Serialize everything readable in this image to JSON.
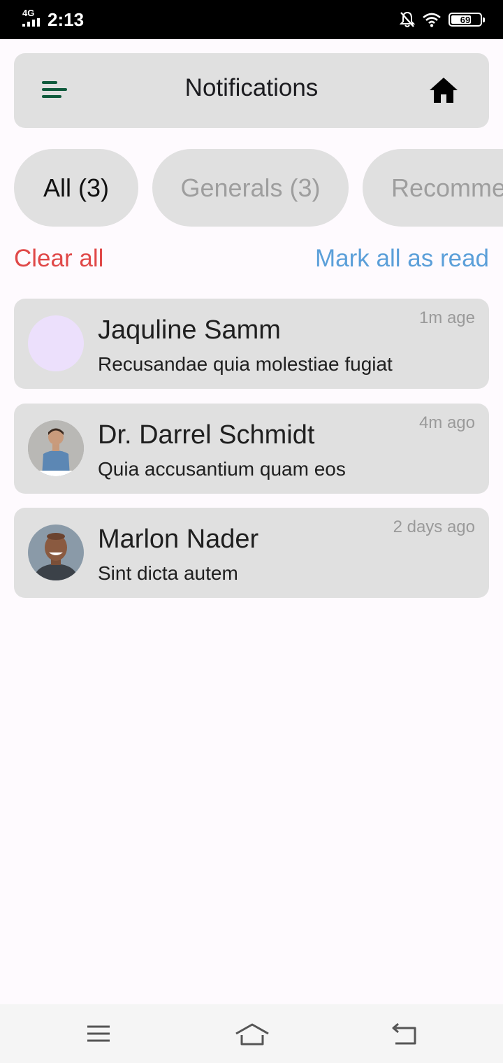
{
  "status_bar": {
    "network": "4G",
    "time": "2:13",
    "battery": "69",
    "battery_level": 0.69
  },
  "header": {
    "title": "Notifications",
    "menu_icon": "menu-icon",
    "home_icon": "home-icon"
  },
  "tabs": [
    {
      "label": "All (3)",
      "active": true
    },
    {
      "label": "Generals (3)",
      "active": false
    },
    {
      "label": "Recomme",
      "active": false
    }
  ],
  "actions": {
    "clear_all": "Clear all",
    "mark_all_read": "Mark all as read"
  },
  "notifications": [
    {
      "name": "Jaquline Samm",
      "message": "Recusandae quia molestiae fugiat",
      "time": "1m age"
    },
    {
      "name": "Dr. Darrel Schmidt",
      "message": "Quia accusantium quam eos",
      "time": "4m ago"
    },
    {
      "name": "Marlon Nader",
      "message": "Sint dicta autem",
      "time": "2 days ago"
    }
  ],
  "colors": {
    "clear_all": "#e04848",
    "mark_read": "#5b9fd9",
    "card_bg": "#e0e0e0",
    "menu_icon": "#0f5a3c"
  },
  "nav": {
    "left_icon": "menu-lines-icon",
    "center_icon": "home-outline-icon",
    "right_icon": "back-icon"
  }
}
